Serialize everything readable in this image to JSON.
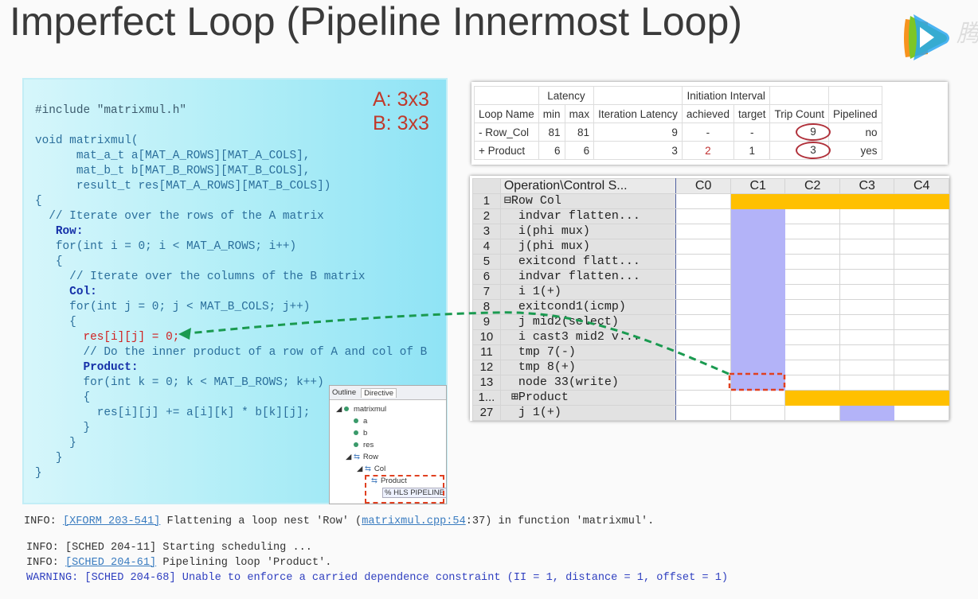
{
  "slide": {
    "title": "Imperfect Loop (Pipeline Innermost Loop)"
  },
  "logo": {
    "name": "tencent-video-logo",
    "text": "腾 不"
  },
  "dims": {
    "a": "A: 3x3",
    "b": "B: 3x3"
  },
  "code": [
    {
      "t": "#include \"matrixmul.h\"",
      "s": "inc"
    },
    {
      "t": "",
      "s": ""
    },
    {
      "t": "void matrixmul(",
      "s": ""
    },
    {
      "t": "      mat_a_t a[MAT_A_ROWS][MAT_A_COLS],",
      "s": ""
    },
    {
      "t": "      mat_b_t b[MAT_B_ROWS][MAT_B_COLS],",
      "s": ""
    },
    {
      "t": "      result_t res[MAT_A_ROWS][MAT_B_COLS])",
      "s": ""
    },
    {
      "t": "{",
      "s": ""
    },
    {
      "t": "  // Iterate over the rows of the A matrix",
      "s": ""
    },
    {
      "t": "   Row:",
      "s": "lbl"
    },
    {
      "t": "   for(int i = 0; i < MAT_A_ROWS; i++)",
      "s": ""
    },
    {
      "t": "   {",
      "s": ""
    },
    {
      "t": "     // Iterate over the columns of the B matrix",
      "s": ""
    },
    {
      "t": "     Col:",
      "s": "lbl"
    },
    {
      "t": "     for(int j = 0; j < MAT_B_COLS; j++)",
      "s": ""
    },
    {
      "t": "     {",
      "s": ""
    },
    {
      "t": "       res[i][j] = 0;",
      "s": "red"
    },
    {
      "t": "       // Do the inner product of a row of A and col of B",
      "s": ""
    },
    {
      "t": "       Product:",
      "s": "lbl"
    },
    {
      "t": "       for(int k = 0; k < MAT_B_ROWS; k++)",
      "s": ""
    },
    {
      "t": "       {",
      "s": ""
    },
    {
      "t": "         res[i][j] += a[i][k] * b[k][j];",
      "s": ""
    },
    {
      "t": "       }",
      "s": ""
    },
    {
      "t": "     }",
      "s": ""
    },
    {
      "t": "   }",
      "s": ""
    },
    {
      "t": "}",
      "s": ""
    }
  ],
  "outline": {
    "tabs": [
      "Outline",
      "Directive"
    ],
    "items": [
      "matrixmul",
      "a",
      "b",
      "res",
      "Row",
      "Col",
      "Product"
    ],
    "directive": "% HLS PIPELINE"
  },
  "latency_table": {
    "group_headers": {
      "latency": "Latency",
      "ii": "Initiation Interval"
    },
    "headers": [
      "Loop Name",
      "min",
      "max",
      "Iteration Latency",
      "achieved",
      "target",
      "Trip Count",
      "Pipelined"
    ],
    "rows": [
      [
        "- Row_Col",
        "81",
        "81",
        "9",
        "-",
        "-",
        "9",
        "no"
      ],
      [
        "+ Product",
        "6",
        "6",
        "3",
        "2",
        "1",
        "3",
        "yes"
      ]
    ]
  },
  "schedule": {
    "header": "Operation\\Control S...",
    "steps": [
      "C0",
      "C1",
      "C2",
      "C3",
      "C4"
    ],
    "rows": [
      {
        "n": "1",
        "op": "⊟Row Col",
        "cells": [
          "",
          "orange",
          "orange",
          "orange",
          "orange"
        ]
      },
      {
        "n": "2",
        "op": "  indvar flatten...",
        "cells": [
          "",
          "blue",
          "",
          "",
          ""
        ]
      },
      {
        "n": "3",
        "op": "  i(phi mux)",
        "cells": [
          "",
          "blue",
          "",
          "",
          ""
        ]
      },
      {
        "n": "4",
        "op": "  j(phi mux)",
        "cells": [
          "",
          "blue",
          "",
          "",
          ""
        ]
      },
      {
        "n": "5",
        "op": "  exitcond flatt...",
        "cells": [
          "",
          "blue",
          "",
          "",
          ""
        ]
      },
      {
        "n": "6",
        "op": "  indvar flatten...",
        "cells": [
          "",
          "blue",
          "",
          "",
          ""
        ]
      },
      {
        "n": "7",
        "op": "  i 1(+)",
        "cells": [
          "",
          "blue",
          "",
          "",
          ""
        ]
      },
      {
        "n": "8",
        "op": "  exitcond1(icmp)",
        "cells": [
          "",
          "blue",
          "",
          "",
          ""
        ]
      },
      {
        "n": "9",
        "op": "  j mid2(select)",
        "cells": [
          "",
          "blue",
          "",
          "",
          ""
        ]
      },
      {
        "n": "10",
        "op": "  i cast3 mid2 v...",
        "cells": [
          "",
          "blue",
          "",
          "",
          ""
        ]
      },
      {
        "n": "11",
        "op": "  tmp 7(-)",
        "cells": [
          "",
          "blue",
          "",
          "",
          ""
        ]
      },
      {
        "n": "12",
        "op": "  tmp 8(+)",
        "cells": [
          "",
          "blue",
          "",
          "",
          ""
        ]
      },
      {
        "n": "13",
        "op": "  node 33(write)",
        "cells": [
          "",
          "blue",
          "",
          "",
          ""
        ]
      },
      {
        "n": "1...",
        "op": " ⊞Product",
        "cells": [
          "",
          "",
          "orange",
          "orange",
          "orange"
        ]
      },
      {
        "n": "27",
        "op": "  j 1(+)",
        "cells": [
          "",
          "",
          "",
          "blue",
          ""
        ]
      }
    ]
  },
  "log": {
    "l1": {
      "pre": "INFO: ",
      "link": "[XFORM 203-541]",
      "mid": " Flattening a loop nest 'Row' (",
      "link2": "matrixmul.cpp:54",
      "post": ":37) in function 'matrixmul'."
    },
    "l2": "INFO: [SCHED 204-11] Starting scheduling ...",
    "l3": {
      "pre": "INFO: ",
      "link": "[SCHED 204-61]",
      "post": " Pipelining loop 'Product'."
    },
    "l4": "WARNING: [SCHED 204-68] Unable to enforce a carried dependence constraint (II = 1, distance = 1, offset = 1)"
  },
  "colors": {
    "pipeline_bar": "#ffc000",
    "op_cell": "#b3b3f8",
    "highlight": "#e04020",
    "arrow": "#1a9a50",
    "circle": "#b0303a"
  }
}
